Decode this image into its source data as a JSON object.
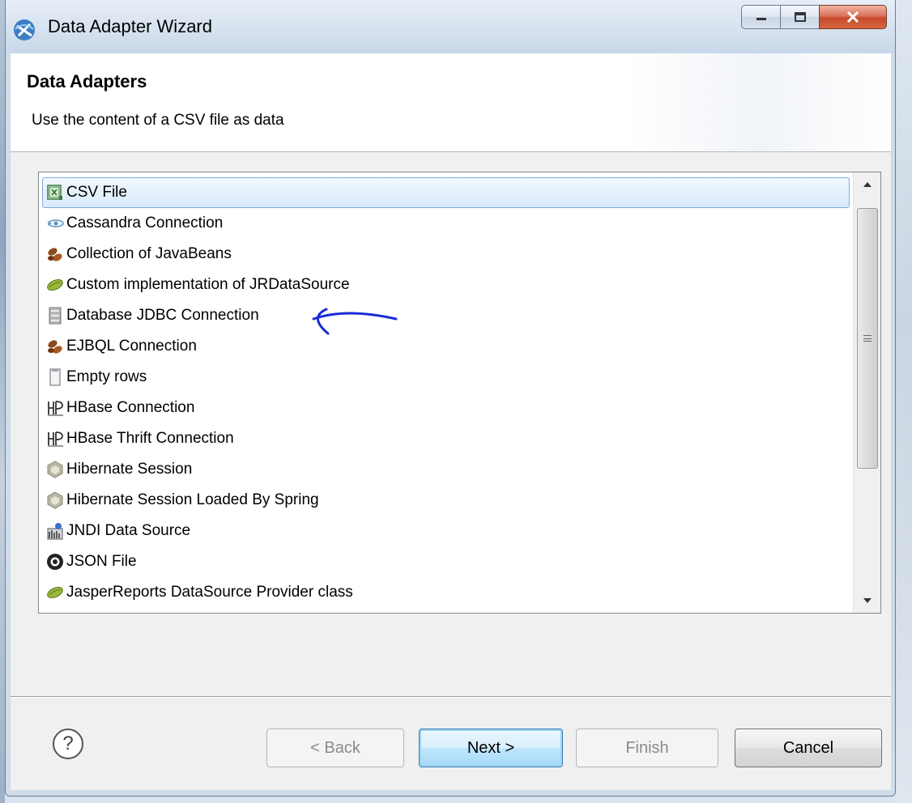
{
  "window": {
    "title": "Data Adapter Wizard",
    "icons": {
      "app": "wizard-icon",
      "minimize": "minimize-icon",
      "maximize": "maximize-icon",
      "close": "close-icon"
    }
  },
  "header": {
    "title": "Data Adapters",
    "description": "Use the content of a CSV file as data"
  },
  "adapters": {
    "selected_index": 0,
    "items": [
      {
        "label": "CSV File",
        "icon": "csv-file-icon"
      },
      {
        "label": "Cassandra Connection",
        "icon": "cassandra-eye-icon"
      },
      {
        "label": "Collection of JavaBeans",
        "icon": "java-beans-icon"
      },
      {
        "label": "Custom implementation of JRDataSource",
        "icon": "bean-pod-icon"
      },
      {
        "label": "Database JDBC Connection",
        "icon": "database-icon"
      },
      {
        "label": "EJBQL Connection",
        "icon": "java-beans-icon"
      },
      {
        "label": "Empty rows",
        "icon": "empty-rows-icon"
      },
      {
        "label": "HBase Connection",
        "icon": "hbase-icon"
      },
      {
        "label": "HBase Thrift Connection",
        "icon": "hbase-icon"
      },
      {
        "label": "Hibernate Session",
        "icon": "hibernate-icon"
      },
      {
        "label": "Hibernate Session Loaded By Spring",
        "icon": "hibernate-icon"
      },
      {
        "label": "JNDI Data Source",
        "icon": "jndi-icon"
      },
      {
        "label": "JSON File",
        "icon": "json-icon"
      },
      {
        "label": "JasperReports DataSource Provider class",
        "icon": "bean-pod-icon"
      }
    ]
  },
  "buttons": {
    "back": "< Back",
    "next": "Next >",
    "finish": "Finish",
    "cancel": "Cancel",
    "help": "?"
  }
}
